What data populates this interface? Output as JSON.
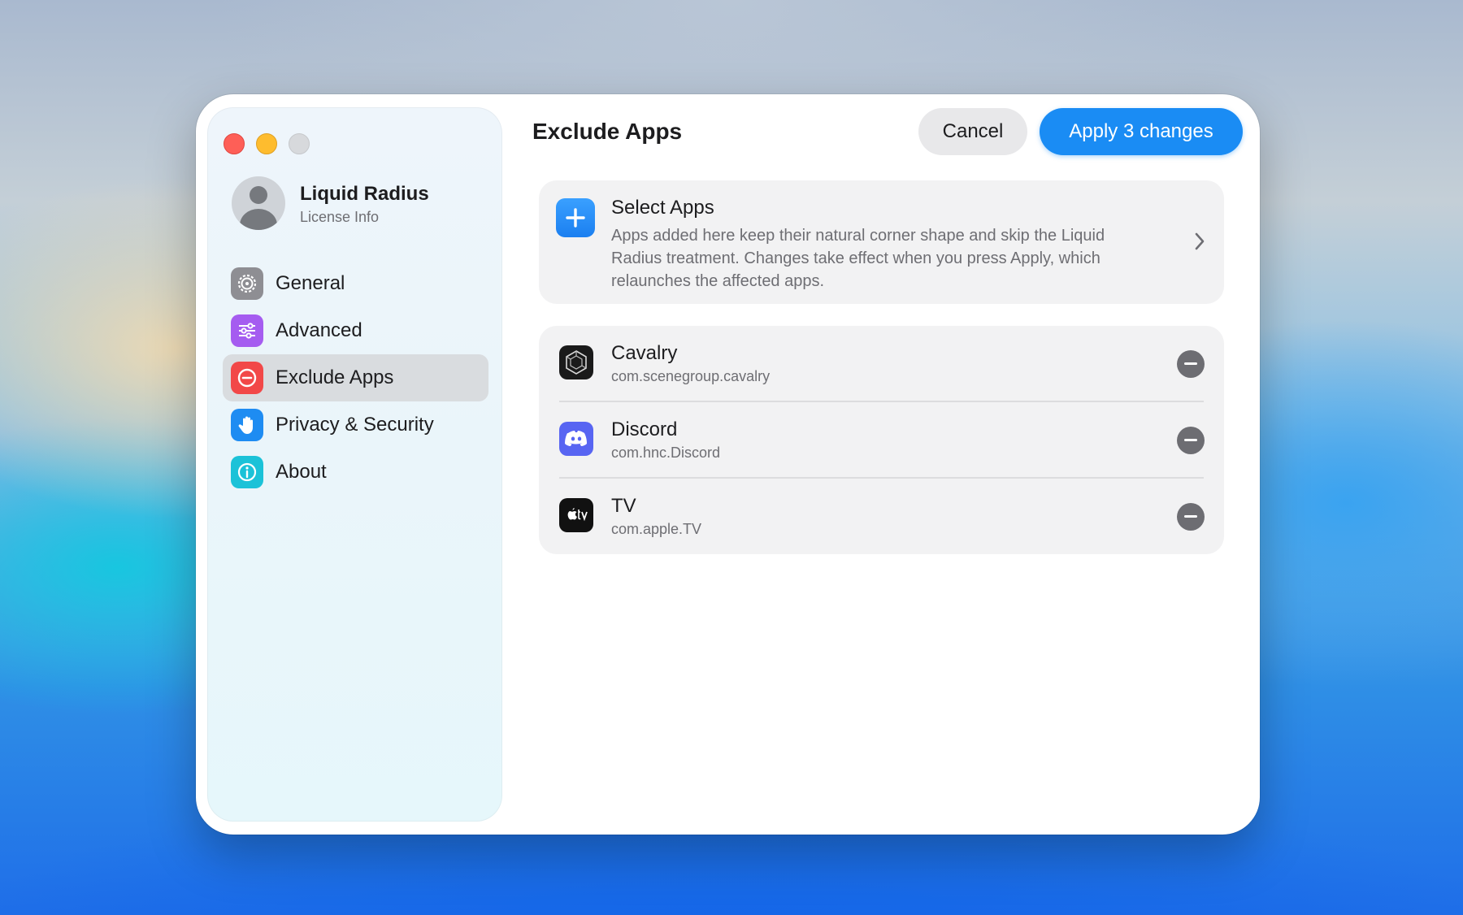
{
  "window": {
    "traffic_lights": [
      "close",
      "minimize",
      "zoom"
    ]
  },
  "profile": {
    "name": "Liquid Radius",
    "subtitle": "License Info",
    "icon": "person-icon"
  },
  "sidebar": {
    "items": [
      {
        "label": "General",
        "icon": "gear-icon",
        "color": "#8e8e93",
        "active": false
      },
      {
        "label": "Advanced",
        "icon": "sliders-icon",
        "color": "#a55cf0",
        "active": false
      },
      {
        "label": "Exclude Apps",
        "icon": "minus-circle-icon",
        "color": "#f24848",
        "active": true
      },
      {
        "label": "Privacy & Security",
        "icon": "hand-icon",
        "color": "#1e8cf2",
        "active": false
      },
      {
        "label": "About",
        "icon": "info-icon",
        "color": "#1bc2d8",
        "active": false
      }
    ]
  },
  "header": {
    "title": "Exclude Apps",
    "cancel_label": "Cancel",
    "apply_label": "Apply 3 changes"
  },
  "select_apps": {
    "title": "Select Apps",
    "description": "Apps added here keep their natural corner shape and skip the Liquid Radius treatment. Changes take effect when you press Apply, which relaunches the affected apps.",
    "icon": "plus-icon"
  },
  "apps": [
    {
      "name": "Cavalry",
      "bundle": "com.scenegroup.cavalry",
      "icon": "cavalry-app-icon"
    },
    {
      "name": "Discord",
      "bundle": "com.hnc.Discord",
      "icon": "discord-app-icon"
    },
    {
      "name": "TV",
      "bundle": "com.apple.TV",
      "icon": "apple-tv-app-icon"
    }
  ],
  "colors": {
    "accent": "#1a8cf4",
    "remove": "#6d6d72"
  }
}
